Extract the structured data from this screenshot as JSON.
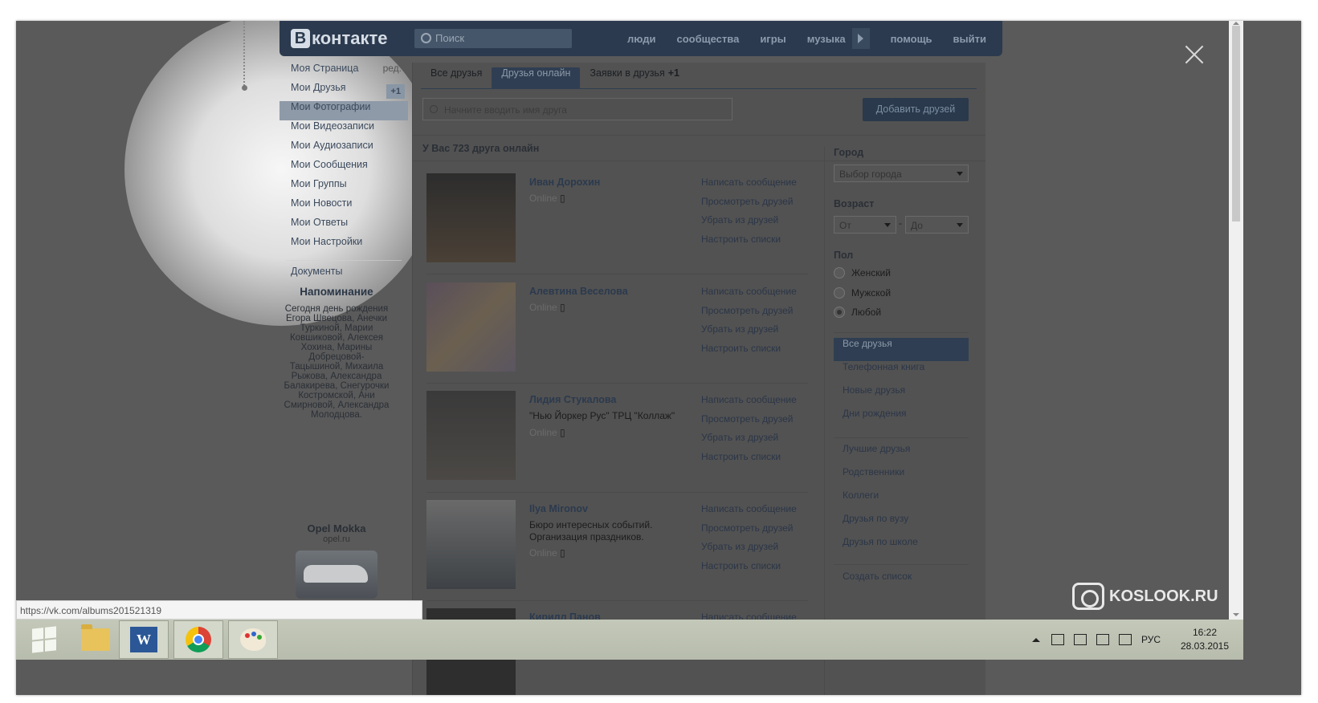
{
  "vk": {
    "logo_b": "В",
    "logo_text": "контакте",
    "search_placeholder": "Поиск",
    "nav": [
      "люди",
      "сообщества",
      "игры",
      "музыка",
      "помощь",
      "выйти"
    ]
  },
  "left_menu": {
    "items": [
      {
        "label": "Моя Страница",
        "right": "ред."
      },
      {
        "label": "Мои Друзья",
        "badge": "+1"
      },
      {
        "label": "Мои Фотографии"
      },
      {
        "label": "Мои Видеозаписи"
      },
      {
        "label": "Мои Аудиозаписи"
      },
      {
        "label": "Мои Сообщения"
      },
      {
        "label": "Мои Группы"
      },
      {
        "label": "Мои Новости"
      },
      {
        "label": "Мои Ответы"
      },
      {
        "label": "Мои Настройки"
      },
      {
        "label": "Документы"
      }
    ],
    "reminder_title": "Напоминание",
    "reminder_text": "Сегодня день рождения Егора Швецова, Анечки Туркиной, Марии Ковшиковой, Алексея Хохина, Марины Добрецовой-Тацышиной, Михаила Рыжова, Александра Балакирева, Снегурочки Костромской, Ани Смирновой, Александра Молодцова.",
    "ad_title": "Opel Mokka",
    "ad_url": "opel.ru"
  },
  "tabs": {
    "all": "Все друзья",
    "online": "Друзья онлайн",
    "requests": "Заявки в друзья",
    "requests_count": "+1"
  },
  "friend_search_placeholder": "Начните вводить имя друга",
  "add_friends_button": "Добавить друзей",
  "online_count_title": "У Вас 723 друга онлайн",
  "friends": [
    {
      "name": "Иван Дорохин",
      "info": "",
      "status": "Online"
    },
    {
      "name": "Алевтина Веселова",
      "info": "",
      "status": "Online"
    },
    {
      "name": "Лидия Стукалова",
      "info": "\"Нью Йоркер Рус\" ТРЦ \"Коллаж\"",
      "status": "Online"
    },
    {
      "name": "Ilya Mironov",
      "info": "Бюро интересных событий. Организация праздников.",
      "status": "Online"
    },
    {
      "name": "Кирилл Панов",
      "info": "",
      "status": ""
    }
  ],
  "friend_actions": [
    "Написать сообщение",
    "Просмотреть друзей",
    "Убрать из друзей",
    "Настроить списки"
  ],
  "filters": {
    "city_label": "Город",
    "city_select": "Выбор города",
    "age_label": "Возраст",
    "age_from": "От",
    "age_to": "До",
    "age_dash": "-",
    "gender_label": "Пол",
    "gender_options": [
      "Женский",
      "Мужской",
      "Любой"
    ],
    "gender_selected": "Любой",
    "lists_a": [
      "Все друзья",
      "Телефонная книга",
      "Новые друзья",
      "Дни рождения"
    ],
    "lists_b": [
      "Лучшие друзья",
      "Родственники",
      "Коллеги",
      "Друзья по вузу",
      "Друзья по школе"
    ],
    "create_list": "Создать список"
  },
  "browser": {
    "status_url": "https://vk.com/albums201521319"
  },
  "watermark": "KOSLOOK.RU",
  "taskbar": {
    "language": "РУС",
    "time": "16:22",
    "date": "28.03.2015"
  }
}
